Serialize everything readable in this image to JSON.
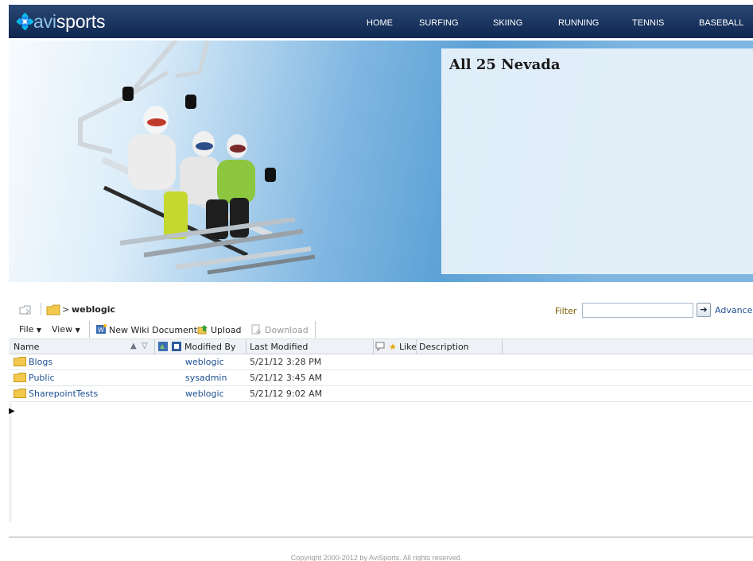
{
  "brand": {
    "name_prefix": "avi",
    "name_suffix": "sports"
  },
  "nav": [
    "HOME",
    "SURFING",
    "SKIING",
    "RUNNING",
    "TENNIS",
    "BASEBALL"
  ],
  "banner": {
    "title": "All 25 Nevada"
  },
  "breadcrumb": {
    "separator": ">",
    "current": "weblogic"
  },
  "filter": {
    "label": "Filter",
    "value": "",
    "advanced_label": "Advanced"
  },
  "toolbar": {
    "file_label": "File",
    "view_label": "View",
    "new_wiki_label": "New Wiki Document",
    "upload_label": "Upload",
    "download_label": "Download"
  },
  "columns": {
    "name": "Name",
    "modified_by": "Modified By",
    "last_modified": "Last Modified",
    "like": "Like",
    "description": "Description"
  },
  "rows": [
    {
      "name": "Blogs",
      "modified_by": "weblogic",
      "last_modified": "5/21/12 3:28 PM"
    },
    {
      "name": "Public",
      "modified_by": "sysadmin",
      "last_modified": "5/21/12 3:45 AM"
    },
    {
      "name": "SharepointTests",
      "modified_by": "weblogic",
      "last_modified": "5/21/12 9:02 AM"
    }
  ],
  "footer": {
    "copyright": "Copyright 2000-2012 by AviSports. All rights reserved."
  },
  "colors": {
    "header_top": "#2b4774",
    "header_bottom": "#0e2750",
    "link": "#1d4f91",
    "folder": "#f2c94c"
  }
}
